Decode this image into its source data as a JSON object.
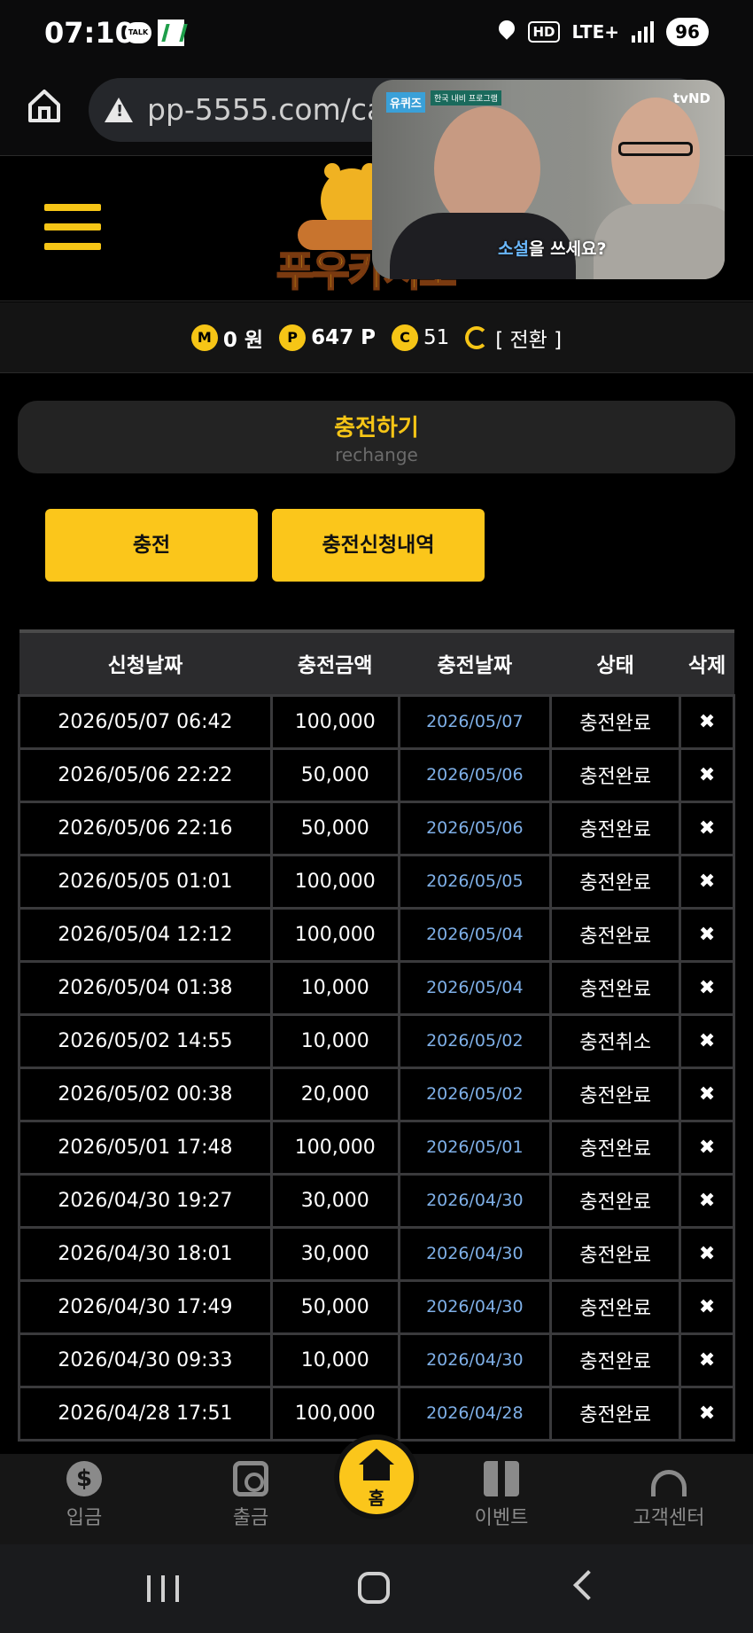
{
  "status_bar": {
    "time": "07:10",
    "talk_badge": "TALK",
    "hd_label": "HD",
    "network": "LTE+",
    "battery": "96"
  },
  "browser": {
    "url": "pp-5555.com/cas"
  },
  "video": {
    "logo_left": "유퀴즈",
    "tag": "한국 내비 프로그램",
    "logo_right": "tvND",
    "subtitle_highlight": "소설",
    "subtitle_rest": "을 쓰세요?"
  },
  "site": {
    "logo_text": "푸우카지노"
  },
  "balance": {
    "m_icon": "M",
    "m_value": "0 원",
    "p_icon": "P",
    "p_value": "647 P",
    "c_icon": "C",
    "c_value": "51",
    "switch_label": "[ 전환 ]"
  },
  "section": {
    "title": "충전하기",
    "subtitle": "rechange"
  },
  "buttons": {
    "charge": "충전",
    "history": "충전신청내역"
  },
  "table": {
    "headers": [
      "신청날짜",
      "충전금액",
      "충전날짜",
      "상태",
      "삭제"
    ],
    "delete_symbol": "✖",
    "rows": [
      {
        "req": "2026/05/07 06:42",
        "amount": "100,000",
        "date": "2026/05/07",
        "status": "충전완료"
      },
      {
        "req": "2026/05/06 22:22",
        "amount": "50,000",
        "date": "2026/05/06",
        "status": "충전완료"
      },
      {
        "req": "2026/05/06 22:16",
        "amount": "50,000",
        "date": "2026/05/06",
        "status": "충전완료"
      },
      {
        "req": "2026/05/05 01:01",
        "amount": "100,000",
        "date": "2026/05/05",
        "status": "충전완료"
      },
      {
        "req": "2026/05/04 12:12",
        "amount": "100,000",
        "date": "2026/05/04",
        "status": "충전완료"
      },
      {
        "req": "2026/05/04 01:38",
        "amount": "10,000",
        "date": "2026/05/04",
        "status": "충전완료"
      },
      {
        "req": "2026/05/02 14:55",
        "amount": "10,000",
        "date": "2026/05/02",
        "status": "충전취소"
      },
      {
        "req": "2026/05/02 00:38",
        "amount": "20,000",
        "date": "2026/05/02",
        "status": "충전완료"
      },
      {
        "req": "2026/05/01 17:48",
        "amount": "100,000",
        "date": "2026/05/01",
        "status": "충전완료"
      },
      {
        "req": "2026/04/30 19:27",
        "amount": "30,000",
        "date": "2026/04/30",
        "status": "충전완료"
      },
      {
        "req": "2026/04/30 18:01",
        "amount": "30,000",
        "date": "2026/04/30",
        "status": "충전완료"
      },
      {
        "req": "2026/04/30 17:49",
        "amount": "50,000",
        "date": "2026/04/30",
        "status": "충전완료"
      },
      {
        "req": "2026/04/30 09:33",
        "amount": "10,000",
        "date": "2026/04/30",
        "status": "충전완료"
      },
      {
        "req": "2026/04/28 17:51",
        "amount": "100,000",
        "date": "2026/04/28",
        "status": "충전완료"
      }
    ]
  },
  "bottom_nav": {
    "deposit": "입금",
    "withdraw": "출금",
    "home": "홈",
    "event": "이벤트",
    "support": "고객센터",
    "dollar_symbol": "$"
  },
  "colors": {
    "accent": "#fbc61b",
    "date_link": "#7fb0e8",
    "background": "#000000"
  },
  "icons": [
    "home-icon",
    "warning-icon",
    "menu-icon",
    "refresh-icon",
    "dollar-icon",
    "safe-icon",
    "house-icon",
    "gift-icon",
    "headset-icon"
  ]
}
